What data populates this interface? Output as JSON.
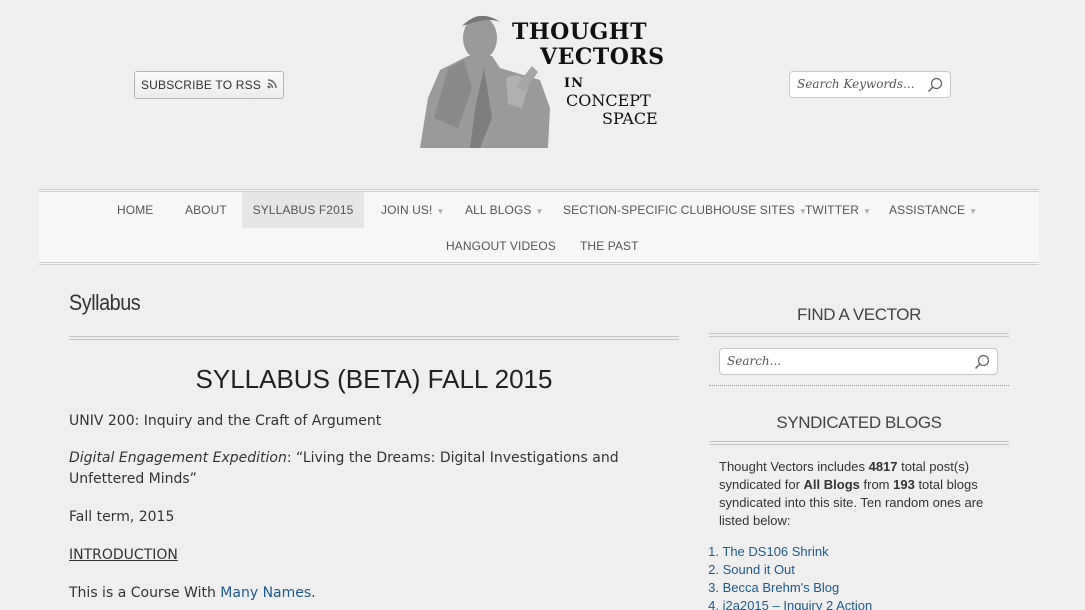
{
  "header": {
    "rss_label": "SUBSCRIBE TO RSS",
    "logo": {
      "line1": "THOUGHT",
      "line2": "VECTORS",
      "line3": "IN",
      "line4": "CONCEPT",
      "line5": "SPACE"
    },
    "search_placeholder": "Search Keywords..."
  },
  "nav": {
    "items": [
      {
        "label": "HOME"
      },
      {
        "label": "ABOUT"
      },
      {
        "label": "SYLLABUS F2015",
        "active": true
      },
      {
        "label": "JOIN US!"
      },
      {
        "label": "ALL BLOGS"
      },
      {
        "label": "SECTION-SPECIFIC CLUBHOUSE SITES"
      },
      {
        "label": "TWITTER"
      },
      {
        "label": "ASSISTANCE"
      },
      {
        "label": "HANGOUT VIDEOS"
      },
      {
        "label": "THE PAST"
      }
    ]
  },
  "main": {
    "page_title": "Syllabus",
    "heading": "SYLLABUS (BETA) FALL 2015",
    "course": "UNIV 200: Inquiry and the Craft of Argument",
    "expedition_label": "Digital Engagement Expedition",
    "expedition_text": ": “Living the Dreams: Digital Investigations and Unfettered Minds”",
    "term": "Fall term, 2015",
    "intro_heading": "INTRODUCTION",
    "intro_prefix": "This is a Course With ",
    "intro_link": "Many Names",
    "intro_suffix": "."
  },
  "sidebar": {
    "find_heading": "FIND A VECTOR",
    "search_placeholder": "Search...",
    "syndicated_heading": "SYNDICATED BLOGS",
    "synd": {
      "t1": "Thought Vectors includes ",
      "posts": "4817",
      "t2": " total post(s) syndicated for ",
      "all_blogs": "All Blogs",
      "t3": " from ",
      "blogs": "193",
      "t4": " total blogs syndicated into this site. Ten random ones are listed below:"
    },
    "blogs": [
      {
        "num": "1.",
        "name": "The DS106 Shrink"
      },
      {
        "num": "2.",
        "name": "Sound it Out"
      },
      {
        "num": "3.",
        "name": "Becca Brehm's Blog"
      },
      {
        "num": "4.",
        "name": "i2a2015 – Inquiry 2 Action"
      }
    ]
  }
}
